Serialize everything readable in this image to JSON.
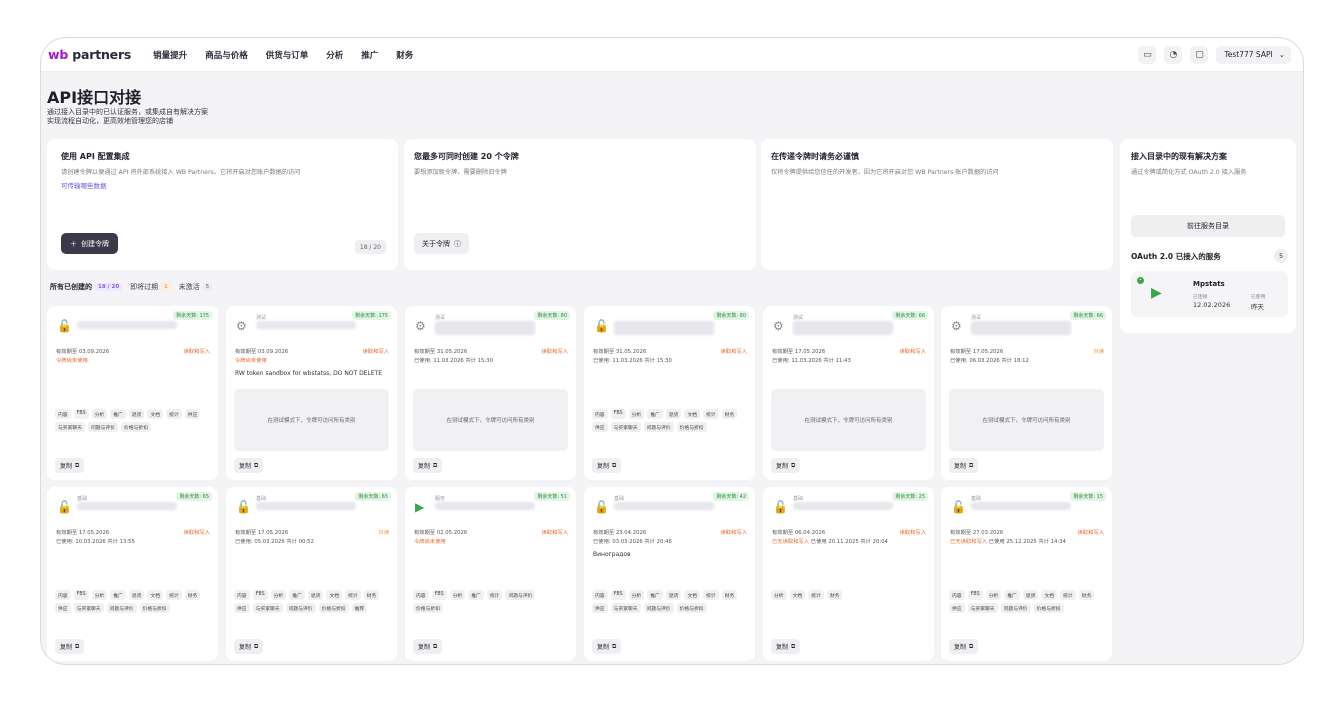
{
  "logo": {
    "wb": "wb",
    "partners": "partners"
  },
  "nav": [
    "销量提升",
    "商品与价格",
    "供货与订单",
    "分析",
    "推广",
    "财务"
  ],
  "header": {
    "account": "Test777 SAPI"
  },
  "hero": {
    "title": "API接口对接",
    "lines": [
      "通过接入目录中的已认证服务，或集成自有解决方案",
      "实现流程自动化，更高效地管理您的店铺"
    ]
  },
  "tiles": {
    "integrate": {
      "title": "使用 API 配置集成",
      "desc": "请创建令牌以便通过 API 将外部系统接入 WB Partners。它将开启对您账户数据的访问",
      "link": "可传输哪些数据",
      "button": "创建令牌",
      "counter": "18 / 20"
    },
    "limit": {
      "title": "您最多可同时创建 20 个令牌",
      "desc": "要想添加新令牌，需要删除旧令牌",
      "button": "关于令牌"
    },
    "caution": {
      "title": "在传递令牌时请务必谨慎",
      "desc": "仅将令牌提供给您信任的开发者，因为它将开启对您 WB Partners 账户数据的访问"
    }
  },
  "filters": [
    {
      "label": "所有已创建的",
      "badge": "18 / 20",
      "badge_color": "#8b5cf6",
      "badge_bg": "#efe7ff"
    },
    {
      "label": "即将过期",
      "badge": "1",
      "badge_color": "#f08a1a",
      "badge_bg": "#fdeedd"
    },
    {
      "label": "未激活",
      "badge": "5",
      "badge_color": "#666",
      "badge_bg": "#ececf0"
    }
  ],
  "cards": [
    {
      "type": "",
      "days": "剩余天数: 175",
      "valid": "有效期至 03.09.2026",
      "mode": "读取和写入",
      "used": "令牌尚未使用",
      "used_warn": true,
      "tags": [
        "内容",
        "FBS",
        "分析",
        "推广",
        "退货",
        "文档",
        "统计",
        "供应",
        "与买家聊天",
        "问题与评价",
        "价格与折扣"
      ],
      "icon": "lock"
    },
    {
      "type": "测试",
      "days": "剩余天数: 175",
      "valid": "有效期至 03.09.2026",
      "mode": "读取和写入",
      "used": "令牌尚未使用",
      "used_warn": true,
      "note": "RW token sandbox for wbstatss, DO NOT DELETE",
      "sandbox": "在测试模式下，令牌可访问所有类别",
      "icon": "gear"
    },
    {
      "type": "测试",
      "days": "剩余天数: 80",
      "valid": "有效期至 31.05.2026",
      "mode": "读取和写入",
      "used": "已使用: 11.03.2026 共计 15:30",
      "used_warn": false,
      "sandbox": "在测试模式下，令牌可访问所有类别",
      "icon": "gear",
      "twoline": true
    },
    {
      "type": "",
      "days": "剩余天数: 80",
      "valid": "有效期至 31.05.2026",
      "mode": "读取和写入",
      "used": "已使用: 11.03.2026 共计 15:30",
      "used_warn": false,
      "tags": [
        "内容",
        "FBS",
        "分析",
        "推广",
        "退货",
        "文档",
        "统计",
        "财务",
        "供应",
        "与买家聊天",
        "问题与评价",
        "价格与折扣"
      ],
      "icon": "lock",
      "twoline": true
    },
    {
      "type": "测试",
      "days": "剩余天数: 66",
      "valid": "有效期至 17.05.2026",
      "mode": "读取和写入",
      "used": "已使用: 11.03.2026 共计 11:43",
      "used_warn": false,
      "sandbox": "在测试模式下，令牌可访问所有类别",
      "icon": "gear",
      "twoline": true
    },
    {
      "type": "测试",
      "days": "剩余天数: 66",
      "valid": "有效期至 17.05.2026",
      "mode": "只读",
      "used": "已使用: 06.03.2026 共计 18:12",
      "used_warn": false,
      "sandbox": "在测试模式下，令牌可访问所有类别",
      "icon": "gear",
      "twoline": true,
      "mode_orange": true
    },
    {
      "type": "基础",
      "days": "剩余天数: 65",
      "valid": "有效期至 17.05.2026",
      "mode": "读取和写入",
      "used": "已使用: 10.03.2026 共计 13:55",
      "used_warn": false,
      "tags": [
        "内容",
        "FBS",
        "分析",
        "推广",
        "退货",
        "文档",
        "统计",
        "财务",
        "供应",
        "与买家聊天",
        "问题与评价",
        "价格与折扣"
      ],
      "icon": "lock"
    },
    {
      "type": "基础",
      "days": "剩余天数: 65",
      "valid": "有效期至 17.05.2026",
      "mode": "只读",
      "used": "已使用: 05.03.2026 共计 00:52",
      "used_warn": false,
      "tags": [
        "内容",
        "FBS",
        "分析",
        "推广",
        "退货",
        "文档",
        "统计",
        "财务",
        "供应",
        "与买家聊天",
        "问题与评价",
        "价格与折扣",
        "推荐"
      ],
      "icon": "lock",
      "mode_orange": true
    },
    {
      "type": "服务",
      "days": "剩余天数: 51",
      "valid": "有效期至 02.05.2026",
      "mode": "读取和写入",
      "used": "令牌尚未使用",
      "used_warn": true,
      "tags": [
        "内容",
        "FBS",
        "分析",
        "推广",
        "统计",
        "问题与评价",
        "价格与折扣"
      ],
      "icon": "logo"
    },
    {
      "type": "基础",
      "days": "剩余天数: 42",
      "valid": "有效期至 23.04.2026",
      "mode": "读取和写入",
      "used": "已使用: 03.03.2026 共计 20:46",
      "used_warn": false,
      "note": "Виноградов",
      "tags": [
        "内容",
        "FBS",
        "分析",
        "推广",
        "退货",
        "文档",
        "统计",
        "财务",
        "供应",
        "与买家聊天",
        "问题与评价",
        "价格与折扣"
      ],
      "icon": "lock"
    },
    {
      "type": "基础",
      "days": "剩余天数: 25",
      "valid": "有效期至 06.04.2026",
      "mode": "读取和写入",
      "used_warn_part": "已无读取和写入",
      "used": "已使用 20.11.2025 共计 20:04",
      "used_warn": false,
      "tags": [
        "分析",
        "文档",
        "统计",
        "财务"
      ],
      "icon": "lock"
    },
    {
      "type": "基础",
      "days": "剩余天数: 15",
      "valid": "有效期至 27.03.2026",
      "mode": "读取和写入",
      "used_warn_part": "已无读取和写入",
      "used": "已使用 25.12.2025 共计 14:34",
      "used_warn": false,
      "tags": [
        "内容",
        "FBS",
        "分析",
        "推广",
        "退货",
        "文档",
        "统计",
        "财务",
        "供应",
        "与买家聊天",
        "问题与评价",
        "价格与折扣"
      ],
      "icon": "lock"
    }
  ],
  "copy_label": "复制",
  "side": {
    "title": "接入目录中的现有解决方案",
    "desc": "通过令牌或简化方式 OAuth 2.0 接入服务",
    "button": "前往服务目录",
    "oauth_title": "OAuth 2.0 已接入的服务",
    "oauth_count": "5",
    "service": {
      "name": "Mpstats",
      "l1": "已连接",
      "v1": "12.02.2026",
      "l2": "已使用",
      "v2": "昨天"
    }
  },
  "colors": {
    "brand": "#a31acb",
    "dark_button": "#3b3a4b",
    "green": "#3aa54b",
    "warn": "#e8662c"
  }
}
